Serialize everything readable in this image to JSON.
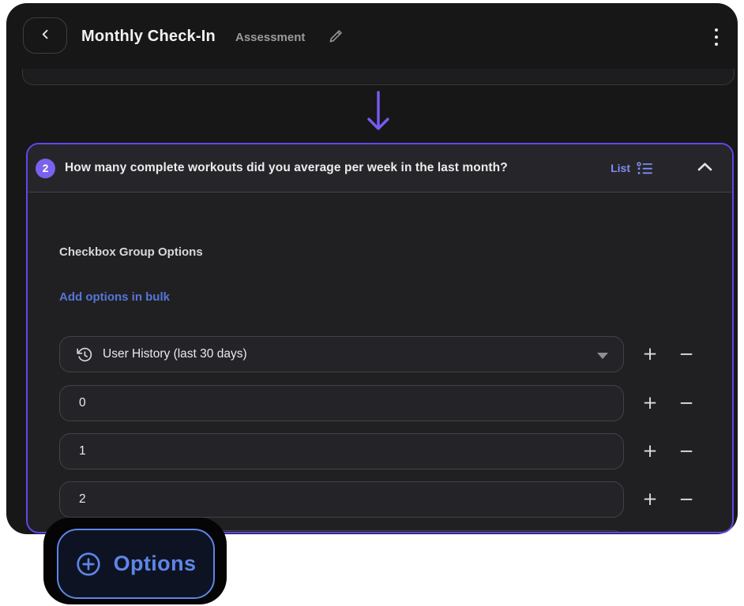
{
  "header": {
    "title": "Monthly Check-In",
    "subtitle": "Assessment"
  },
  "question": {
    "number": "2",
    "text": "How many complete workouts did you average per week in the last month?",
    "type_label": "List"
  },
  "panel": {
    "heading": "Checkbox Group Options",
    "bulk_link": "Add options in bulk"
  },
  "options": {
    "dropdown_value": "User History (last 30 days)",
    "rows": [
      {
        "value": "0"
      },
      {
        "value": "1"
      },
      {
        "value": "2"
      }
    ]
  },
  "controls": {
    "plus": "+",
    "minus": "−"
  },
  "footer": {
    "options_button_label": "Options"
  },
  "icons": {
    "back": "chevron-left",
    "edit": "pencil",
    "menu": "kebab-vertical",
    "flow": "arrow-down",
    "question_type": "list-bullets",
    "collapse": "chevron-up",
    "dropdown_leading": "history-clock",
    "dropdown_caret": "caret-down",
    "row_add": "plus",
    "row_remove": "minus",
    "options_button": "plus-circle"
  },
  "colors": {
    "accent_purple": "#5f48e8",
    "badge_purple": "#7a62ee",
    "list_label_blue": "#7e8df2",
    "link_blue": "#5676d6",
    "options_blue": "#5f85e8",
    "window_bg": "#171718",
    "card_bg": "#202023",
    "input_bg": "#242428"
  }
}
